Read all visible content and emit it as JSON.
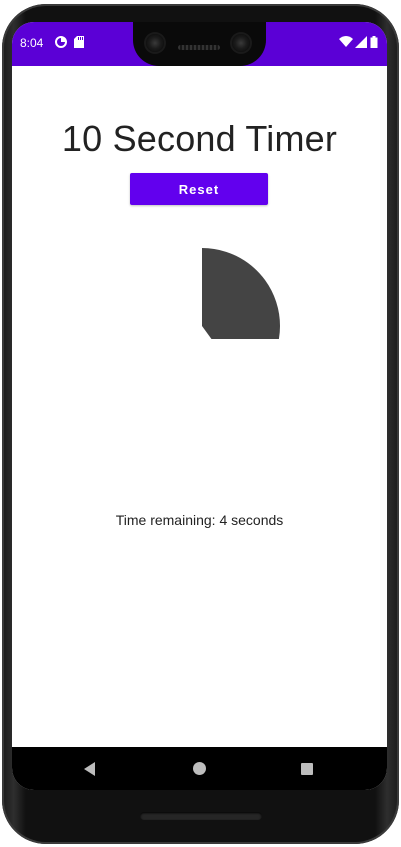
{
  "status_bar": {
    "time": "8:04",
    "icons": [
      "data-saver-icon",
      "sd-card-icon",
      "wifi-icon",
      "signal-icon",
      "battery-icon"
    ],
    "background_color": "#5b00d6"
  },
  "app": {
    "title": "10 Second Timer",
    "reset_label": "Reset",
    "accent_color": "#6200ee",
    "remaining_text": "Time remaining: 4 seconds",
    "timer_fraction": 0.4,
    "timer_color": "#444444"
  },
  "nav_bar": {
    "icons": [
      "back-icon",
      "home-icon",
      "recents-icon"
    ]
  }
}
